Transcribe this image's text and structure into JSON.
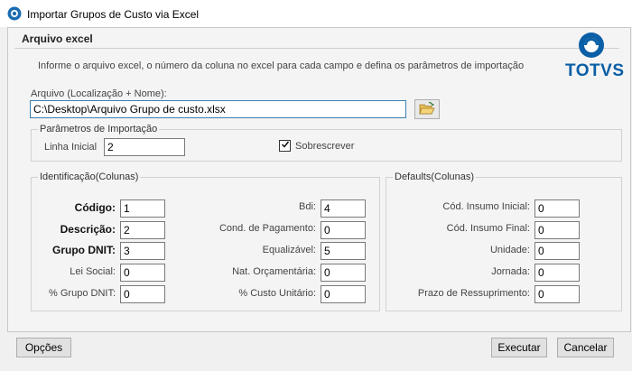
{
  "window": {
    "title": "Importar Grupos de Custo via Excel"
  },
  "panel": {
    "title": "Arquivo excel",
    "instructions": "Informe o arquivo excel, o número da coluna no excel para cada campo e defina os parâmetros de importação"
  },
  "brand": {
    "name": "TOTVS",
    "color": "#0a5fa6"
  },
  "file": {
    "label": "Arquivo (Localização + Nome):",
    "value": "C:\\Desktop\\Arquivo Grupo de custo.xlsx"
  },
  "params": {
    "title": "Parâmetros de Importação",
    "linha_inicial_label": "Linha Inicial",
    "linha_inicial_value": "2",
    "sobrescrever_label": "Sobrescrever",
    "sobrescrever_checked": true
  },
  "ident": {
    "title": "Identificação(Colunas)",
    "codigo_label": "Código:",
    "codigo_value": "1",
    "descricao_label": "Descrição:",
    "descricao_value": "2",
    "grupo_dnit_label": "Grupo DNIT:",
    "grupo_dnit_value": "3",
    "lei_social_label": "Lei Social:",
    "lei_social_value": "0",
    "pct_grupo_dnit_label": "% Grupo DNIT:",
    "pct_grupo_dnit_value": "0",
    "bdi_label": "Bdi:",
    "bdi_value": "4",
    "cond_pagamento_label": "Cond. de Pagamento:",
    "cond_pagamento_value": "0",
    "equalizavel_label": "Equalizável:",
    "equalizavel_value": "5",
    "nat_orcamentaria_label": "Nat. Orçamentária:",
    "nat_orcamentaria_value": "0",
    "pct_custo_unitario_label": "% Custo Unitário:",
    "pct_custo_unitario_value": "0"
  },
  "defaults": {
    "title": "Defaults(Colunas)",
    "cod_insumo_inicial_label": "Cód. Insumo Inicial:",
    "cod_insumo_inicial_value": "0",
    "cod_insumo_final_label": "Cód. Insumo Final:",
    "cod_insumo_final_value": "0",
    "unidade_label": "Unidade:",
    "unidade_value": "0",
    "jornada_label": "Jornada:",
    "jornada_value": "0",
    "prazo_ressuprimento_label": "Prazo de Ressuprimento:",
    "prazo_ressuprimento_value": "0"
  },
  "buttons": {
    "opcoes": "Opções",
    "executar": "Executar",
    "cancelar": "Cancelar"
  }
}
